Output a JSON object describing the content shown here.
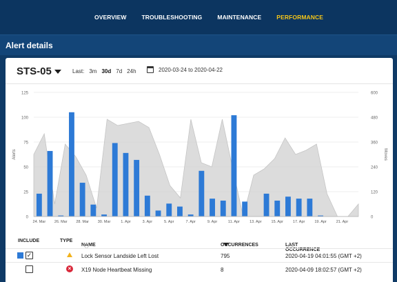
{
  "nav": {
    "items": [
      {
        "label": "OVERVIEW",
        "active": false
      },
      {
        "label": "TROUBLESHOOTING",
        "active": false
      },
      {
        "label": "MAINTENANCE",
        "active": false
      },
      {
        "label": "PERFORMANCE",
        "active": true
      }
    ]
  },
  "page": {
    "title": "Alert details"
  },
  "header": {
    "device": "STS-05",
    "last_label": "Last:",
    "ranges": [
      "3m",
      "30d",
      "7d",
      "24h"
    ],
    "selected_range": "30d",
    "date_range": "2020-03-24 to 2020-04-22"
  },
  "colors": {
    "accent": "#f5c518",
    "bar": "#2d7ad6",
    "area": "#d6d6d6",
    "nav_bg": "#0c3560"
  },
  "chart_data": {
    "type": "bar",
    "left_axis": {
      "label": "Alerts",
      "ticks": [
        "0",
        "25",
        "50",
        "75",
        "100",
        "125"
      ],
      "range": [
        0,
        125
      ]
    },
    "right_axis": {
      "label": "Moves",
      "ticks": [
        "0",
        "120",
        "240",
        "360",
        "480",
        "600"
      ],
      "range": [
        0,
        600
      ]
    },
    "x_labels": [
      "24. Mar",
      "26. Mar",
      "28. Mar",
      "30. Mar",
      "1. Apr",
      "3. Apr",
      "5. Apr",
      "7. Apr",
      "9. Apr",
      "11. Apr",
      "13. Apr",
      "15. Apr",
      "17. Apr",
      "19. Apr",
      "21. Apr"
    ],
    "days": [
      "24. Mar",
      "25. Mar",
      "26. Mar",
      "27. Mar",
      "28. Mar",
      "29. Mar",
      "30. Mar",
      "31. Mar",
      "1. Apr",
      "2. Apr",
      "3. Apr",
      "4. Apr",
      "5. Apr",
      "6. Apr",
      "7. Apr",
      "8. Apr",
      "9. Apr",
      "10. Apr",
      "11. Apr",
      "12. Apr",
      "13. Apr",
      "14. Apr",
      "15. Apr",
      "16. Apr",
      "17. Apr",
      "18. Apr",
      "19. Apr",
      "20. Apr",
      "21. Apr",
      "22. Apr"
    ],
    "series": [
      {
        "kind": "bar",
        "axis": "left",
        "color": "#2d7ad6",
        "values": [
          23,
          66,
          1,
          105,
          34,
          12,
          2,
          74,
          64,
          57,
          21,
          6,
          13,
          10,
          2,
          46,
          18,
          16,
          102,
          15,
          0,
          23,
          16,
          20,
          18,
          18,
          1,
          0,
          0,
          0
        ]
      },
      {
        "kind": "area",
        "axis": "right",
        "color": "#d6d6d6",
        "values": [
          300,
          400,
          60,
          350,
          290,
          200,
          40,
          470,
          440,
          450,
          460,
          430,
          300,
          150,
          90,
          470,
          260,
          240,
          470,
          230,
          0,
          200,
          230,
          280,
          380,
          300,
          320,
          350,
          110,
          0,
          0,
          60
        ]
      }
    ],
    "grid": true
  },
  "table": {
    "columns": [
      {
        "label": "INCLUDE"
      },
      {
        "label": "TYPE"
      },
      {
        "label": "NAME"
      },
      {
        "label": "OCCURRENCES"
      },
      {
        "label": "LAST OCCURRENCE"
      }
    ],
    "rows": [
      {
        "included": true,
        "type": "warning",
        "check": "✓",
        "name": "Lock Sensor Landside Left Lost",
        "occurrences": "795",
        "last": "2020-04-19 04:01:55 (GMT +2)"
      },
      {
        "included": false,
        "type": "error",
        "check": "",
        "name": "X19 Node Heartbeat Missing",
        "occurrences": "8",
        "last": "2020-04-09 18:02:57 (GMT +2)"
      }
    ]
  }
}
